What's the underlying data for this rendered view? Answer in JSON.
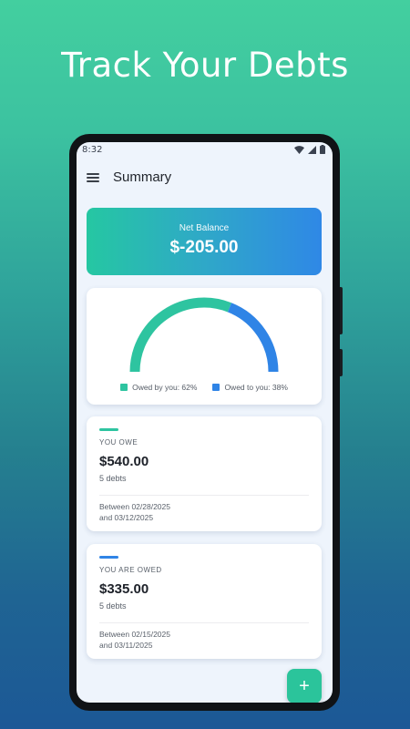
{
  "headline": "Track Your Debts",
  "status_bar": {
    "time": "8:32"
  },
  "app_bar": {
    "title": "Summary"
  },
  "balance": {
    "label": "Net Balance",
    "value": "$-205.00"
  },
  "gauge": {
    "owed_by_you_fraction": 0.62,
    "owed_to_you_fraction": 0.38,
    "legend": [
      {
        "label": "Owed by you: 62%",
        "color": "#2ec4a0"
      },
      {
        "label": "Owed to you: 38%",
        "color": "#2f84e6"
      }
    ]
  },
  "you_owe": {
    "caption": "YOU OWE",
    "amount": "$540.00",
    "count": "5 debts",
    "range_line1": "Between 02/28/2025",
    "range_line2": "and 03/12/2025",
    "accent_color": "#2ec4a0"
  },
  "you_are_owed": {
    "caption": "YOU ARE OWED",
    "amount": "$335.00",
    "count": "5 debts",
    "range_line1": "Between 02/15/2025",
    "range_line2": "and 03/11/2025",
    "accent_color": "#2f84e6"
  },
  "fab": {
    "label": "+"
  },
  "icons": {
    "menu": "menu-icon",
    "wifi": "wifi-icon",
    "signal": "signal-icon",
    "battery": "battery-icon"
  }
}
